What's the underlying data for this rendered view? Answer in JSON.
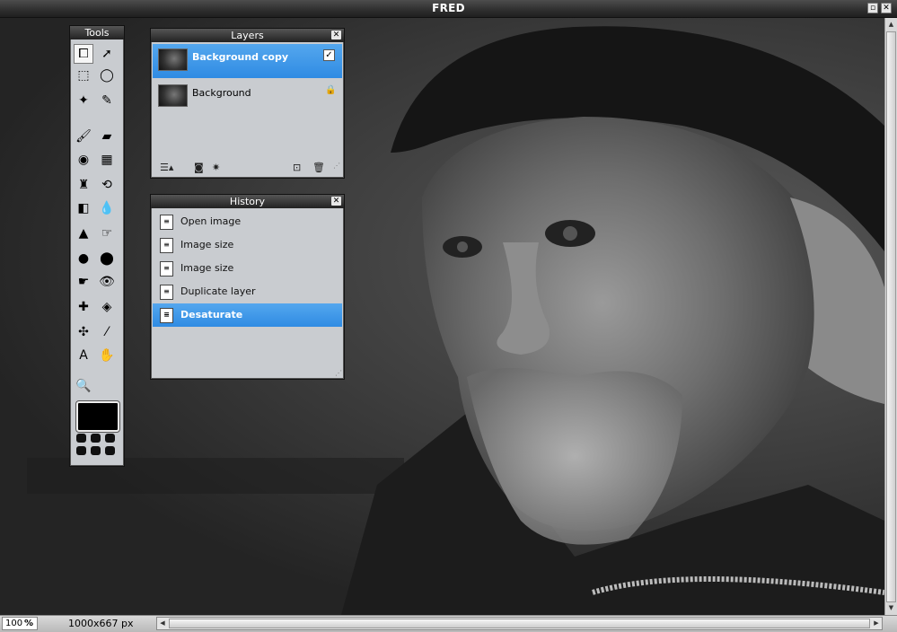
{
  "window": {
    "title": "FRED"
  },
  "tools_panel": {
    "title": "Tools",
    "tools": [
      {
        "name": "crop-tool-icon",
        "glyph": "⧠",
        "active": true
      },
      {
        "name": "move-tool-icon",
        "glyph": "➚"
      },
      {
        "name": "marquee-tool-icon",
        "glyph": "⬚"
      },
      {
        "name": "lasso-tool-icon",
        "glyph": "◯"
      },
      {
        "name": "magic-wand-tool-icon",
        "glyph": "✦"
      },
      {
        "name": "pencil-tool-icon",
        "glyph": "✎"
      },
      {
        "name": "brush-tool-icon",
        "glyph": "🖌"
      },
      {
        "name": "eraser-tool-icon",
        "glyph": "▰"
      },
      {
        "name": "paint-bucket-tool-icon",
        "glyph": "◉"
      },
      {
        "name": "gradient-tool-icon",
        "glyph": "▦"
      },
      {
        "name": "clone-stamp-tool-icon",
        "glyph": "♜"
      },
      {
        "name": "color-replace-tool-icon",
        "glyph": "⟲"
      },
      {
        "name": "shape-tool-icon",
        "glyph": "◧"
      },
      {
        "name": "blur-tool-icon",
        "glyph": "💧"
      },
      {
        "name": "sharpen-tool-icon",
        "glyph": "▲"
      },
      {
        "name": "smudge-tool-icon",
        "glyph": "☞"
      },
      {
        "name": "sponge-tool-icon",
        "glyph": "●"
      },
      {
        "name": "burn-tool-icon",
        "glyph": "⬤"
      },
      {
        "name": "dodge-tool-icon",
        "glyph": "☛"
      },
      {
        "name": "red-eye-tool-icon",
        "glyph": "👁"
      },
      {
        "name": "spot-heal-tool-icon",
        "glyph": "✚"
      },
      {
        "name": "bloat-tool-icon",
        "glyph": "◈"
      },
      {
        "name": "pinch-tool-icon",
        "glyph": "✣"
      },
      {
        "name": "color-picker-tool-icon",
        "glyph": "⁄"
      },
      {
        "name": "type-tool-icon",
        "glyph": "A"
      },
      {
        "name": "hand-tool-icon",
        "glyph": "✋"
      },
      {
        "name": "zoom-tool-icon",
        "glyph": "🔍"
      }
    ]
  },
  "layers_panel": {
    "title": "Layers",
    "layers": [
      {
        "name": "Background copy",
        "selected": true,
        "status": "✓"
      },
      {
        "name": "Background",
        "selected": false,
        "status": "🔒"
      }
    ]
  },
  "history_panel": {
    "title": "History",
    "items": [
      {
        "label": "Open image",
        "selected": false
      },
      {
        "label": "Image size",
        "selected": false
      },
      {
        "label": "Image size",
        "selected": false
      },
      {
        "label": "Duplicate layer",
        "selected": false
      },
      {
        "label": "Desaturate",
        "selected": true
      }
    ]
  },
  "statusbar": {
    "zoom_value": "100",
    "zoom_unit": "%",
    "dimensions": "1000x667 px"
  }
}
